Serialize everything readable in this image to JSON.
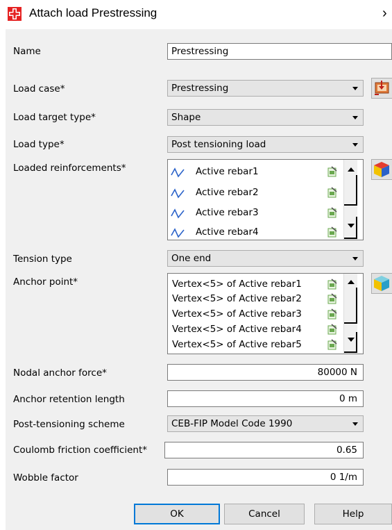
{
  "window": {
    "title": "Attach load Prestressing",
    "close_glyph": "›"
  },
  "form": {
    "name": {
      "label": "Name",
      "value": "Prestressing"
    },
    "load_case": {
      "label": "Load case*",
      "value": "Prestressing"
    },
    "load_target_type": {
      "label": "Load target type*",
      "value": "Shape"
    },
    "load_type": {
      "label": "Load type*",
      "value": "Post tensioning load"
    },
    "loaded_reinforcements": {
      "label": "Loaded reinforcements*",
      "items": [
        "Active rebar1",
        "Active rebar2",
        "Active rebar3",
        "Active rebar4"
      ]
    },
    "tension_type": {
      "label": "Tension type",
      "value": "One end"
    },
    "anchor_point": {
      "label": "Anchor point*",
      "items": [
        "Vertex<5> of Active rebar1",
        "Vertex<5> of Active rebar2",
        "Vertex<5> of Active rebar3",
        "Vertex<5> of Active rebar4",
        "Vertex<5> of Active rebar5"
      ]
    },
    "nodal_anchor_force": {
      "label": "Nodal anchor force*",
      "value": "80000  N"
    },
    "anchor_retention_length": {
      "label": "Anchor retention length",
      "value": "0  m"
    },
    "post_tensioning_scheme": {
      "label": "Post-tensioning scheme",
      "value": "CEB-FIP Model Code 1990"
    },
    "coulomb_friction_coefficient": {
      "label": "Coulomb friction coefficient*",
      "value": "0.65"
    },
    "wobble_factor": {
      "label": "Wobble factor",
      "value": "0  1/m"
    }
  },
  "buttons": {
    "ok": "OK",
    "cancel": "Cancel",
    "help": "Help"
  },
  "icons": {
    "app": "app-logo-icon",
    "load_case_side": "load-case-icon",
    "reinforcement_side": "cube-icon",
    "anchor_side": "cube-icon",
    "rebar": "rebar-icon",
    "edit": "edit-doc-icon"
  },
  "colors": {
    "dialog_bg": "#f0f0f0",
    "combo_bg": "#e5e5e5",
    "default_button_border": "#0078d7",
    "app_icon_red": "#e52222",
    "rebar_blue": "#2a62c9"
  }
}
